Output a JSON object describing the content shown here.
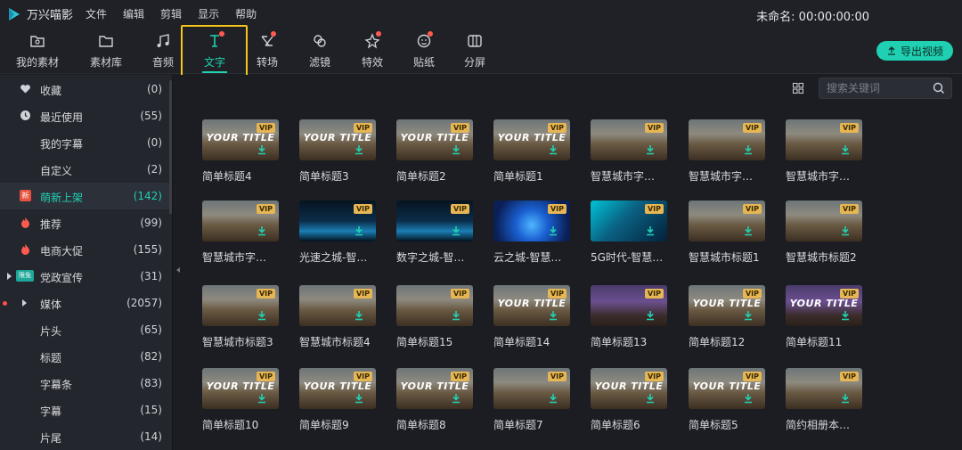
{
  "app": {
    "title": "万兴喵影",
    "menu": [
      "文件",
      "编辑",
      "剪辑",
      "显示",
      "帮助"
    ],
    "project": "未命名: 00:00:00:00"
  },
  "toolbar": {
    "tabs": [
      {
        "label": "我的素材",
        "icon": "folder-user-icon",
        "badge": false
      },
      {
        "label": "素材库",
        "icon": "folder-icon",
        "badge": false
      },
      {
        "label": "音频",
        "icon": "music-note-icon",
        "badge": false
      },
      {
        "label": "文字",
        "icon": "text-icon",
        "badge": true,
        "active": true
      },
      {
        "label": "转场",
        "icon": "transition-icon",
        "badge": true
      },
      {
        "label": "滤镜",
        "icon": "filter-icon",
        "badge": false
      },
      {
        "label": "特效",
        "icon": "effects-icon",
        "badge": true
      },
      {
        "label": "贴纸",
        "icon": "sticker-icon",
        "badge": true
      },
      {
        "label": "分屏",
        "icon": "split-screen-icon",
        "badge": false
      }
    ],
    "export_label": "导出视频"
  },
  "sidebar": {
    "items": [
      {
        "label": "收藏",
        "count": "(0)",
        "icon": "heart-icon"
      },
      {
        "label": "最近使用",
        "count": "(55)",
        "icon": "clock-icon"
      },
      {
        "label": "我的字幕",
        "count": "(0)",
        "icon": ""
      },
      {
        "label": "自定义",
        "count": "(2)",
        "icon": ""
      },
      {
        "label": "萌新上架",
        "count": "(142)",
        "icon": "new-badge-icon",
        "badge_text": "新",
        "selected": true
      },
      {
        "label": "推荐",
        "count": "(99)",
        "icon": "flame-icon"
      },
      {
        "label": "电商大促",
        "count": "(155)",
        "icon": "flame-icon"
      },
      {
        "label": "党政宣传",
        "count": "(31)",
        "icon": "limited-free-badge-icon",
        "badge_text": "限免"
      },
      {
        "label": "媒体",
        "count": "(2057)",
        "icon": "expand-arrow-icon"
      },
      {
        "label": "片头",
        "count": "(65)",
        "icon": ""
      },
      {
        "label": "标题",
        "count": "(82)",
        "icon": ""
      },
      {
        "label": "字幕条",
        "count": "(83)",
        "icon": ""
      },
      {
        "label": "字幕",
        "count": "(15)",
        "icon": ""
      },
      {
        "label": "片尾",
        "count": "(14)",
        "icon": ""
      }
    ]
  },
  "search": {
    "placeholder": "搜索关键词"
  },
  "vip_label": "VIP",
  "tiles": [
    {
      "caption": "简单标题4",
      "overlay": "YOUR TITLE",
      "style": "road"
    },
    {
      "caption": "简单标题3",
      "overlay": "YOUR TITLE",
      "style": "road"
    },
    {
      "caption": "简单标题2",
      "overlay": "YOUR TITLE",
      "style": "road"
    },
    {
      "caption": "简单标题1",
      "overlay": "YOUR TITLE",
      "style": "road"
    },
    {
      "caption": "智慧城市字…",
      "overlay": "",
      "style": "road"
    },
    {
      "caption": "智慧城市字…",
      "overlay": "",
      "style": "road"
    },
    {
      "caption": "智慧城市字…",
      "overlay": "",
      "style": "road"
    },
    {
      "caption": "智慧城市字…",
      "overlay": "",
      "style": "road"
    },
    {
      "caption": "光速之城-智…",
      "overlay": "",
      "style": "city"
    },
    {
      "caption": "数字之城-智…",
      "overlay": "",
      "style": "city"
    },
    {
      "caption": "云之城-智慧…",
      "overlay": "",
      "style": "blue"
    },
    {
      "caption": "5G时代-智慧…",
      "overlay": "",
      "style": "cyan"
    },
    {
      "caption": "智慧城市标题1",
      "overlay": "",
      "style": "road"
    },
    {
      "caption": "智慧城市标题2",
      "overlay": "",
      "style": "road"
    },
    {
      "caption": "智慧城市标题3",
      "overlay": "",
      "style": "road"
    },
    {
      "caption": "智慧城市标题4",
      "overlay": "",
      "style": "road"
    },
    {
      "caption": "简单标题15",
      "overlay": "",
      "style": "road"
    },
    {
      "caption": "简单标题14",
      "overlay": "YOUR TITLE",
      "style": "road"
    },
    {
      "caption": "简单标题13",
      "overlay": "",
      "style": "purple"
    },
    {
      "caption": "简单标题12",
      "overlay": "YOUR TITLE",
      "style": "road"
    },
    {
      "caption": "简单标题11",
      "overlay": "YOUR TITLE",
      "style": "purple"
    },
    {
      "caption": "简单标题10",
      "overlay": "YOUR TITLE",
      "style": "road"
    },
    {
      "caption": "简单标题9",
      "overlay": "YOUR TITLE",
      "style": "road"
    },
    {
      "caption": "简单标题8",
      "overlay": "YOUR TITLE",
      "style": "road"
    },
    {
      "caption": "简单标题7",
      "overlay": "",
      "style": "road"
    },
    {
      "caption": "简单标题6",
      "overlay": "YOUR TITLE",
      "style": "road"
    },
    {
      "caption": "简单标题5",
      "overlay": "YOUR TITLE",
      "style": "road"
    },
    {
      "caption": "简约相册本…",
      "overlay": "",
      "style": "road"
    }
  ],
  "colors": {
    "accent": "#1fd1b2",
    "highlight_frame": "#f5c518",
    "badge_red": "#ff5a4f",
    "vip_gold": "#e6b655"
  }
}
